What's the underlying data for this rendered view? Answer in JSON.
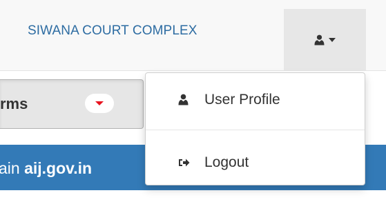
{
  "navbar": {
    "title": "SIWANA COURT COMPLEX",
    "user_icon": "user-icon",
    "caret_icon": "caret-down-icon"
  },
  "forms_button": {
    "label": "rms",
    "caret_icon": "caret-down-icon",
    "caret_color": "#e8131f"
  },
  "banner": {
    "prefix": "ain ",
    "domain": "aij.gov.in"
  },
  "dropdown": {
    "items": [
      {
        "label": "User Profile",
        "icon": "user-icon"
      },
      {
        "label": "Logout",
        "icon": "sign-out-icon"
      }
    ]
  },
  "colors": {
    "brand_blue": "#337ab7",
    "link_blue": "#2d6ca2",
    "navbar_bg": "#f8f8f8",
    "active_bg": "#e7e7e7"
  }
}
